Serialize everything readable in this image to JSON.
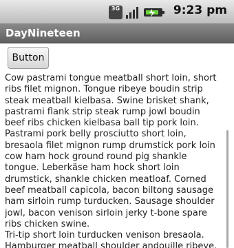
{
  "status_bar": {
    "network_type": "3G",
    "time": "9:23 pm"
  },
  "app": {
    "title": "DayNineteen"
  },
  "button": {
    "label": "Button"
  },
  "body_text": "Cow pastrami tongue meatball short loin, short ribs filet mignon. Tongue ribeye boudin strip steak meatball kielbasa. Swine brisket shank, pastrami flank strip steak rump jowl boudin beef ribs chicken kielbasa ball tip pork loin. Pastrami pork belly prosciutto short loin, bresaola filet mignon rump drumstick pork loin cow ham hock ground round pig shankle tongue. Leberkäse ham hock short loin drumstick, shankle chicken meatloaf. Corned beef meatball capicola, bacon biltong sausage ham sirloin rump turducken. Sausage shoulder jowl, bacon venison sirloin jerky t-bone spare ribs chicken swine.\nTri-tip short loin turducken venison bresaola. Hamburger meatball shoulder andouille ribeye. Ham hock prosciutto turducken, chuck pork belly",
  "icons": {
    "network": "network-type-icon",
    "signal": "signal-strength-icon",
    "battery": "battery-icon"
  },
  "colors": {
    "status_bar": "#d6d6d6",
    "title_bar": "#707070",
    "content_background": "#ffffff"
  }
}
